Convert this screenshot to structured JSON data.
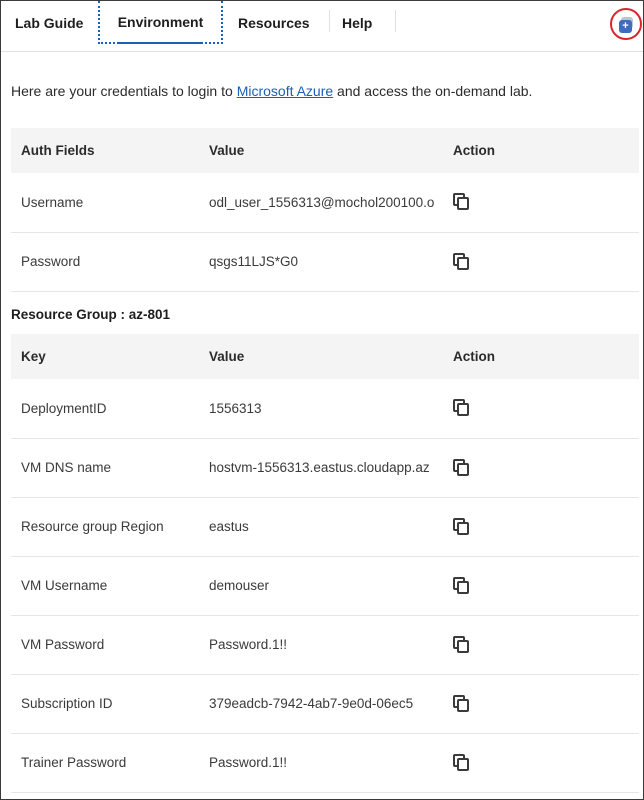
{
  "tabs": {
    "lab_guide": "Lab Guide",
    "environment": "Environment",
    "resources": "Resources",
    "help": "Help"
  },
  "popout": {
    "icon": "popout-window-icon",
    "glyph": "+"
  },
  "intro": {
    "before": "Here are your credentials to login to ",
    "link": "Microsoft Azure",
    "after": " and access the on-demand lab."
  },
  "auth_table": {
    "headers": [
      "Auth Fields",
      "Value",
      "Action"
    ],
    "rows": [
      {
        "field": "Username",
        "value": "odl_user_1556313@mochol200100.o"
      },
      {
        "field": "Password",
        "value": "qsgs11LJS*G0"
      }
    ]
  },
  "resource_group": {
    "heading": "Resource Group : az-801",
    "headers": [
      "Key",
      "Value",
      "Action"
    ],
    "rows": [
      {
        "key": "DeploymentID",
        "value": "1556313"
      },
      {
        "key": "VM DNS name",
        "value": "hostvm-1556313.eastus.cloudapp.az"
      },
      {
        "key": "Resource group Region",
        "value": "eastus"
      },
      {
        "key": "VM Username",
        "value": "demouser"
      },
      {
        "key": "VM Password",
        "value": "Password.1!!"
      },
      {
        "key": "Subscription ID",
        "value": "379eadcb-7942-4ab7-9e0d-06ec5"
      },
      {
        "key": "Trainer Password",
        "value": "Password.1!!"
      }
    ]
  },
  "colors": {
    "accent": "#1a5fb4",
    "popout_ring": "#d9262c",
    "header_bg": "#f4f4f4"
  }
}
